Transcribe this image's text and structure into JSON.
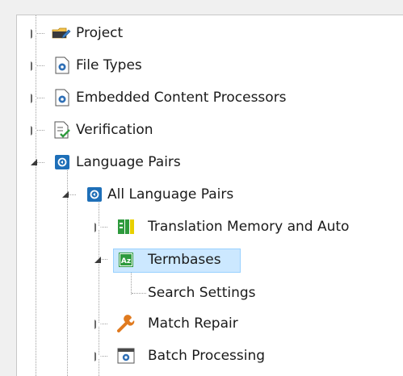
{
  "tree": {
    "items": [
      {
        "label": "Project",
        "icon": "folder-edit-icon"
      },
      {
        "label": "File Types",
        "icon": "settings-document-icon"
      },
      {
        "label": "Embedded Content Processors",
        "icon": "settings-document-icon"
      },
      {
        "label": "Verification",
        "icon": "document-check-icon"
      },
      {
        "label": "Language Pairs",
        "icon": "language-pairs-icon"
      },
      {
        "label": "All Language Pairs",
        "icon": "language-pairs-icon"
      },
      {
        "label": "Translation Memory and Auto",
        "icon": "translation-memory-icon"
      },
      {
        "label": "Termbases",
        "icon": "termbase-icon"
      },
      {
        "label": "Search Settings",
        "icon": ""
      },
      {
        "label": "Match Repair",
        "icon": "wrench-icon"
      },
      {
        "label": "Batch Processing",
        "icon": "batch-settings-icon"
      }
    ],
    "selected": "Termbases"
  },
  "colors": {
    "selection_bg": "#cce8ff",
    "selection_border": "#99d1ff",
    "lang_pair_icon": "#1e6fb8",
    "termbase_icon": "#2e9a3d",
    "wrench_icon": "#e07a1f"
  }
}
